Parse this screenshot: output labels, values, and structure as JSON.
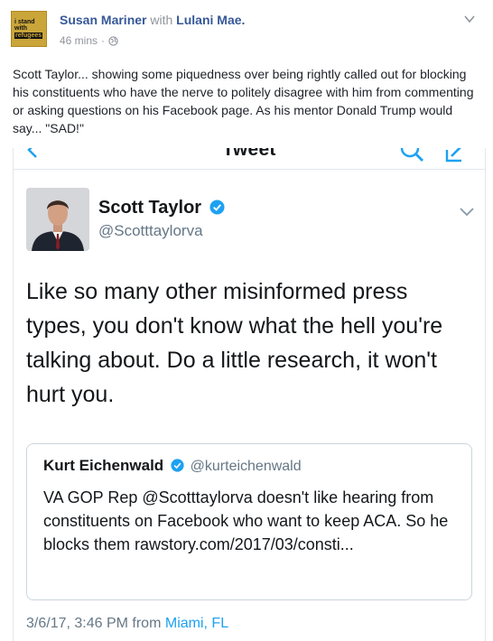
{
  "post": {
    "author": "Susan Mariner",
    "with_word": "with",
    "tagged": "Lulani Mae.",
    "time": "46 mins",
    "separator": "·",
    "avatar_text": [
      "I stand",
      "with",
      "refugees"
    ],
    "text": "Scott Taylor... showing some piquedness over being rightly called out for blocking his constituents who have the nerve to politely disagree with him from commenting or asking questions on his Facebook page. As his mentor Donald Trump would say... \"SAD!\""
  },
  "screenshot": {
    "nav_title": "Tweet",
    "tweet": {
      "name": "Scott Taylor",
      "handle": "@Scotttaylorva",
      "text": "Like so many other misinformed press types, you don't know what the hell you're talking about. Do a little research, it won't hurt you.",
      "date_time": "3/6/17, 3:46 PM from",
      "location": "Miami, FL"
    },
    "quoted": {
      "name": "Kurt Eichenwald",
      "handle": "@kurteichenwald",
      "text": "VA GOP Rep @Scotttaylorva doesn't like hearing from constituents on Facebook who want to keep ACA. So he blocks them rawstory.com/2017/03/consti..."
    }
  },
  "colors": {
    "fb_link": "#365899",
    "fb_meta": "#90949c",
    "twitter_blue": "#1da1f2",
    "twitter_gray": "#657786"
  },
  "icons": [
    "globe-icon",
    "chevron-down-icon",
    "back-arrow-icon",
    "search-icon",
    "compose-icon",
    "verified-icon"
  ]
}
